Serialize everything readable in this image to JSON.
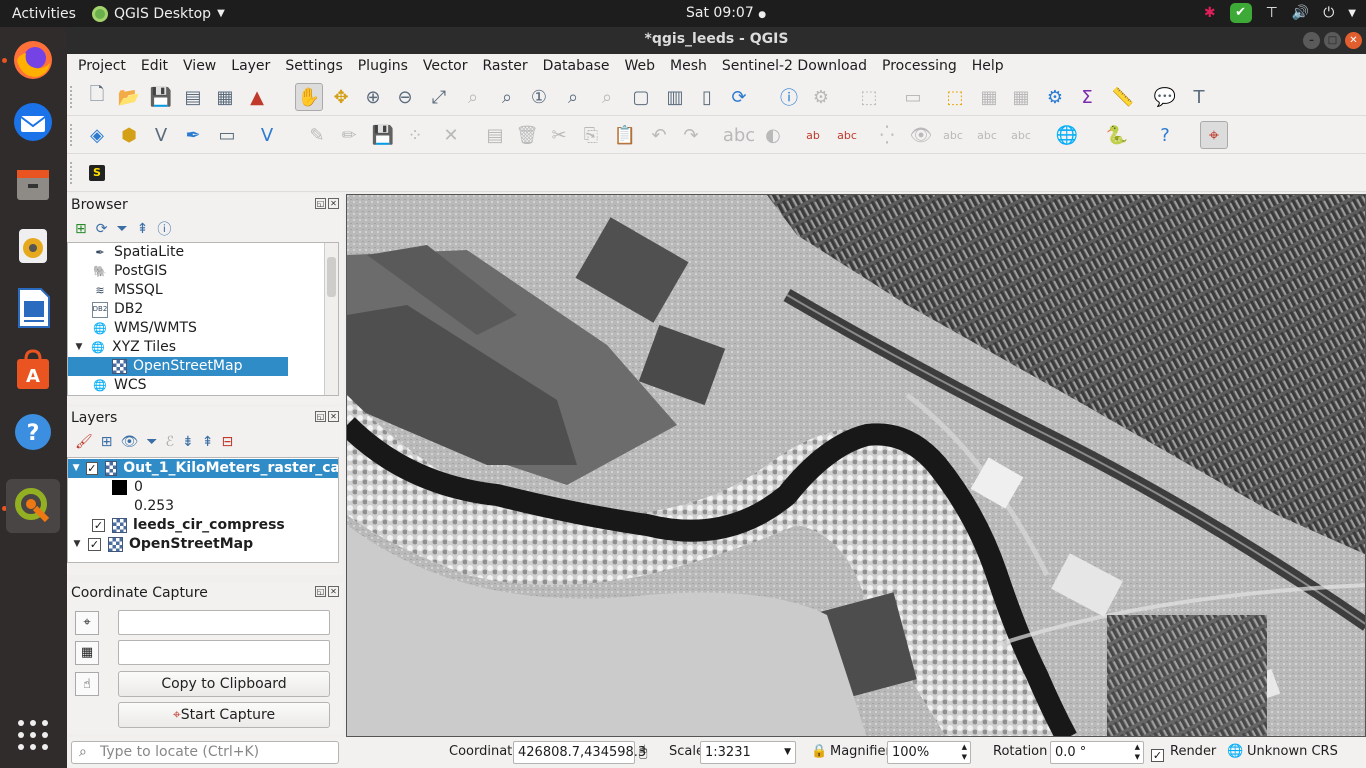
{
  "topbar": {
    "activities": "Activities",
    "app_name": "QGIS Desktop",
    "clock": "Sat 09:07"
  },
  "window": {
    "title": "*qgis_leeds - QGIS"
  },
  "menu": [
    "Project",
    "Edit",
    "View",
    "Layer",
    "Settings",
    "Plugins",
    "Vector",
    "Raster",
    "Database",
    "Web",
    "Mesh",
    "Sentinel-2 Download",
    "Processing",
    "Help"
  ],
  "browser": {
    "title": "Browser",
    "items": [
      {
        "label": "SpatiaLite",
        "icon": "spatialite-icon"
      },
      {
        "label": "PostGIS",
        "icon": "postgis-icon"
      },
      {
        "label": "MSSQL",
        "icon": "mssql-icon"
      },
      {
        "label": "DB2",
        "icon": "db2-icon"
      },
      {
        "label": "WMS/WMTS",
        "icon": "globe-icon"
      },
      {
        "label": "XYZ Tiles",
        "icon": "globe-icon"
      },
      {
        "label": "OpenStreetMap",
        "icon": "xyz-layer-icon"
      },
      {
        "label": "WCS",
        "icon": "globe-icon"
      }
    ]
  },
  "layers": {
    "title": "Layers",
    "items": [
      {
        "label": "Out_1_KiloMeters_raster_ca",
        "checked": true
      },
      {
        "legend_color": "#000000",
        "label": "0"
      },
      {
        "label": "0.253"
      },
      {
        "label": "leeds_cir_compress",
        "checked": true
      },
      {
        "label": "OpenStreetMap",
        "checked": true
      }
    ]
  },
  "coordinate_capture": {
    "title": "Coordinate Capture",
    "field1": "",
    "field2": "",
    "copy_button": "Copy to Clipboard",
    "start_button": "Start Capture"
  },
  "locator": {
    "placeholder": "Type to locate (Ctrl+K)"
  },
  "status": {
    "coordinate_label": "Coordinate",
    "coordinate_value": "426808.7,434598.3",
    "scale_label": "Scale",
    "scale_value": "1:3231",
    "magnifier_label": "Magnifier",
    "magnifier_value": "100%",
    "rotation_label": "Rotation",
    "rotation_value": "0.0 °",
    "render_label": "Render",
    "render_checked": true,
    "crs_label": "Unknown CRS"
  },
  "colors": {
    "selection": "#308cc6",
    "accent": "#e95420"
  }
}
